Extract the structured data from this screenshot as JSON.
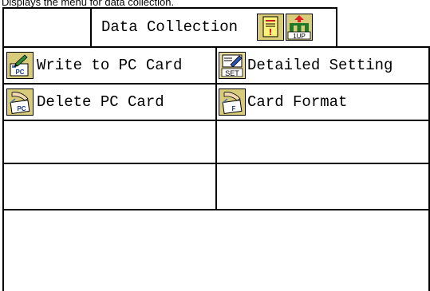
{
  "caption": "Displays the menu for data collection.",
  "header": {
    "title": "Data Collection",
    "alarm_icon": "alarm-memo-icon",
    "up_icon": "hierarchy-up-icon",
    "up_icon_text": "1UP"
  },
  "menu": {
    "write_pc_card": {
      "label": "Write to PC Card",
      "icon": "write-pc-card-icon",
      "icon_text": "PC"
    },
    "detailed_setting": {
      "label": "Detailed Setting",
      "icon": "settings-icon",
      "icon_text": "SET"
    },
    "delete_pc_card": {
      "label": "Delete PC Card",
      "icon": "delete-pc-card-icon",
      "icon_text": "PC"
    },
    "card_format": {
      "label": "Card Format",
      "icon": "card-format-icon",
      "icon_text": "F"
    }
  },
  "colors": {
    "border": "#000000",
    "icon_bg": "#d8cc7a",
    "icon_bg_light": "#e6dc9a",
    "memo_yellow": "#fff27a",
    "up_red": "#e02020",
    "tree_green": "#1e7a2a"
  }
}
